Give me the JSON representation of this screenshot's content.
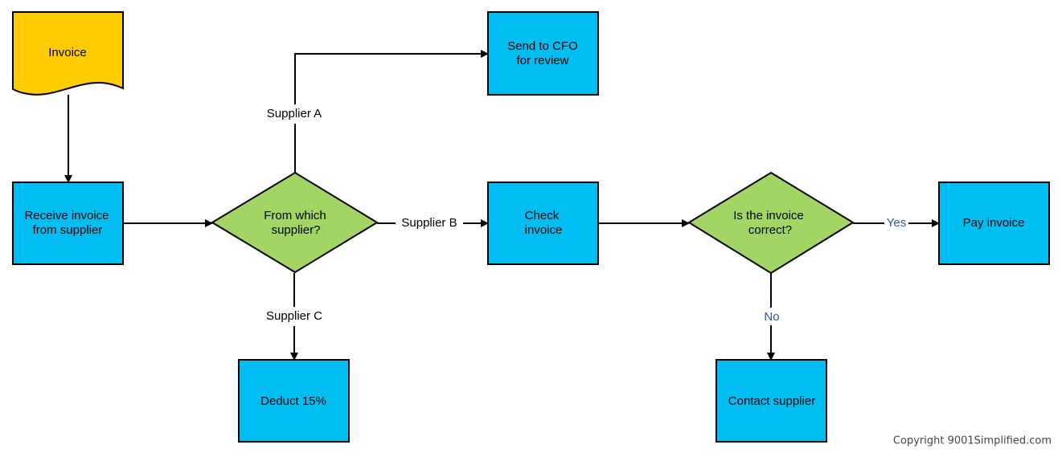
{
  "colors": {
    "document": "#FFCC00",
    "process": "#00BEF2",
    "decision": "#A2D563",
    "edge_label_plain": "#000000",
    "edge_label_yes_no": "#2F5597",
    "copyright": "#444444"
  },
  "nodes": {
    "invoice": {
      "type": "document",
      "lines": [
        "Invoice"
      ]
    },
    "receive": {
      "type": "process",
      "lines": [
        "Receive invoice",
        "from supplier"
      ]
    },
    "which_supplier": {
      "type": "decision",
      "lines": [
        "From which",
        "supplier?"
      ]
    },
    "send_cfo": {
      "type": "process",
      "lines": [
        "Send to CFO",
        "for review"
      ]
    },
    "check": {
      "type": "process",
      "lines": [
        "Check",
        "invoice"
      ]
    },
    "deduct": {
      "type": "process",
      "lines": [
        "Deduct 15%"
      ]
    },
    "is_correct": {
      "type": "decision",
      "lines": [
        "Is the invoice",
        "correct?"
      ]
    },
    "pay": {
      "type": "process",
      "lines": [
        "Pay invoice"
      ]
    },
    "contact": {
      "type": "process",
      "lines": [
        "Contact supplier"
      ]
    }
  },
  "edges": [
    {
      "from": "invoice",
      "to": "receive",
      "label": ""
    },
    {
      "from": "receive",
      "to": "which_supplier",
      "label": ""
    },
    {
      "from": "which_supplier",
      "to": "send_cfo",
      "label": "Supplier A"
    },
    {
      "from": "which_supplier",
      "to": "check",
      "label": "Supplier B"
    },
    {
      "from": "which_supplier",
      "to": "deduct",
      "label": "Supplier C"
    },
    {
      "from": "check",
      "to": "is_correct",
      "label": ""
    },
    {
      "from": "is_correct",
      "to": "pay",
      "label": "Yes"
    },
    {
      "from": "is_correct",
      "to": "contact",
      "label": "No"
    }
  ],
  "copyright": "Copyright 9001Simplified.com"
}
